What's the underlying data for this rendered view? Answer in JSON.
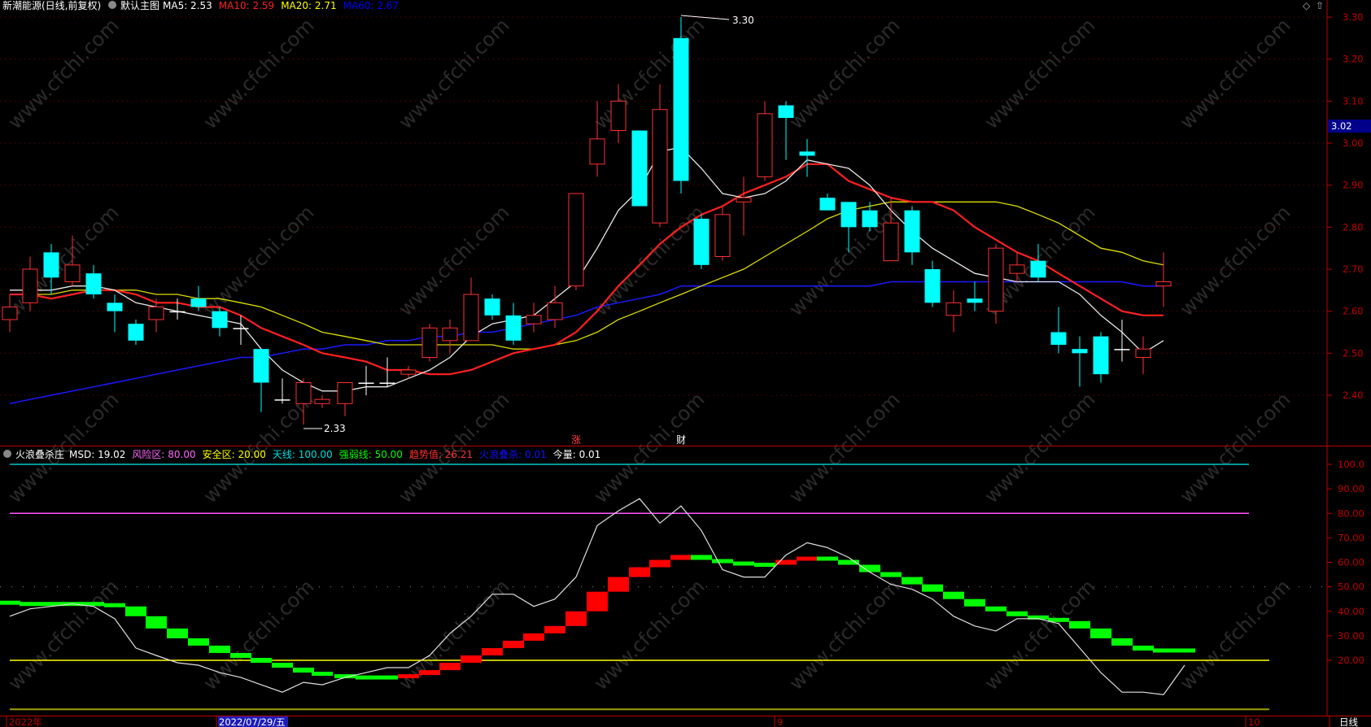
{
  "main_header": {
    "stock_name": "新潮能源(日线,前复权)",
    "indicator_name": "默认主图",
    "items": [
      {
        "text": "MA5: 2.53",
        "color": "#ffffff"
      },
      {
        "text": "MA10: 2.59",
        "color": "#ff2020"
      },
      {
        "text": "MA20: 2.71",
        "color": "#ffff00"
      },
      {
        "text": "MA60: 2.67",
        "color": "#0000ff"
      }
    ]
  },
  "sub_header": {
    "indicator_name": "火浪叠杀庄",
    "items": [
      {
        "text": "MSD: 19.02",
        "color": "#ffffff"
      },
      {
        "text": "风险区: 80.00",
        "color": "#ff66ff"
      },
      {
        "text": "安全区: 20.00",
        "color": "#ffff00"
      },
      {
        "text": "天线: 100.00",
        "color": "#00e0e0"
      },
      {
        "text": "强弱线: 50.00",
        "color": "#00ff00"
      },
      {
        "text": "趋势值: 26.21",
        "color": "#ff3030"
      },
      {
        "text": "火浪叠杀: 0.01",
        "color": "#1010ff"
      },
      {
        "text": "今量: 0.01",
        "color": "#ffffff"
      }
    ]
  },
  "main_annotations": {
    "high": "3.30",
    "low": "2.33",
    "current_price": "3.02",
    "events": [
      {
        "text": "涨",
        "bar_index": 27
      },
      {
        "text": "财",
        "bar_index": 32
      }
    ]
  },
  "bottom_bar": {
    "labels": [
      {
        "text": "2022年",
        "bar_index": 0,
        "highlight": false
      },
      {
        "text": "2022/07/29/五",
        "bar_index": 10,
        "highlight": true
      },
      {
        "text": "9",
        "bar_index": 34,
        "highlight": false
      },
      {
        "text": "10",
        "bar_index": 56,
        "highlight": false
      }
    ],
    "period": "日线"
  },
  "colors": {
    "up": "#ff3030",
    "down": "#00ffff",
    "ma5": "#e8e8e8",
    "ma10": "#ff2020",
    "ma20": "#dddd00",
    "ma60": "#1a1aff",
    "axis": "#c00000",
    "trend_up": "#ff0000",
    "trend_down": "#00ff00",
    "msd": "#e0e0e0",
    "tianxian": "#00c8c8",
    "risk": "#ff55ff",
    "safe": "#ffff00",
    "strong_weak": "#808080"
  },
  "chart_data": [
    {
      "type": "candlestick",
      "title": "新潮能源(日线,前复权)",
      "ylim": [
        2.3,
        3.32
      ],
      "y_ticks": [
        "2.40",
        "2.50",
        "2.60",
        "2.70",
        "2.80",
        "2.90",
        "3.00",
        "3.10",
        "3.20",
        "3.30"
      ],
      "candles": [
        {
          "o": 2.58,
          "c": 2.61,
          "h": 2.64,
          "l": 2.55
        },
        {
          "o": 2.62,
          "c": 2.7,
          "h": 2.73,
          "l": 2.6
        },
        {
          "o": 2.74,
          "c": 2.68,
          "h": 2.76,
          "l": 2.64
        },
        {
          "o": 2.67,
          "c": 2.71,
          "h": 2.78,
          "l": 2.66
        },
        {
          "o": 2.69,
          "c": 2.64,
          "h": 2.71,
          "l": 2.63
        },
        {
          "o": 2.62,
          "c": 2.6,
          "h": 2.64,
          "l": 2.55
        },
        {
          "o": 2.57,
          "c": 2.53,
          "h": 2.58,
          "l": 2.52
        },
        {
          "o": 2.58,
          "c": 2.61,
          "h": 2.63,
          "l": 2.55
        },
        {
          "o": 2.6,
          "c": 2.6,
          "h": 2.63,
          "l": 2.58
        },
        {
          "o": 2.63,
          "c": 2.61,
          "h": 2.66,
          "l": 2.6
        },
        {
          "o": 2.6,
          "c": 2.56,
          "h": 2.61,
          "l": 2.54
        },
        {
          "o": 2.56,
          "c": 2.56,
          "h": 2.59,
          "l": 2.52
        },
        {
          "o": 2.51,
          "c": 2.43,
          "h": 2.51,
          "l": 2.36
        },
        {
          "o": 2.39,
          "c": 2.39,
          "h": 2.44,
          "l": 2.38
        },
        {
          "o": 2.38,
          "c": 2.43,
          "h": 2.44,
          "l": 2.33
        },
        {
          "o": 2.38,
          "c": 2.39,
          "h": 2.4,
          "l": 2.37
        },
        {
          "o": 2.38,
          "c": 2.43,
          "h": 2.43,
          "l": 2.35
        },
        {
          "o": 2.43,
          "c": 2.43,
          "h": 2.47,
          "l": 2.4
        },
        {
          "o": 2.43,
          "c": 2.43,
          "h": 2.49,
          "l": 2.42
        },
        {
          "o": 2.45,
          "c": 2.46,
          "h": 2.47,
          "l": 2.44
        },
        {
          "o": 2.49,
          "c": 2.56,
          "h": 2.57,
          "l": 2.48
        },
        {
          "o": 2.53,
          "c": 2.56,
          "h": 2.58,
          "l": 2.5
        },
        {
          "o": 2.53,
          "c": 2.64,
          "h": 2.68,
          "l": 2.53
        },
        {
          "o": 2.63,
          "c": 2.59,
          "h": 2.64,
          "l": 2.58
        },
        {
          "o": 2.59,
          "c": 2.53,
          "h": 2.62,
          "l": 2.52
        },
        {
          "o": 2.57,
          "c": 2.59,
          "h": 2.62,
          "l": 2.55
        },
        {
          "o": 2.58,
          "c": 2.62,
          "h": 2.66,
          "l": 2.56
        },
        {
          "o": 2.66,
          "c": 2.88,
          "h": 2.88,
          "l": 2.65
        },
        {
          "o": 2.95,
          "c": 3.01,
          "h": 3.1,
          "l": 2.92
        },
        {
          "o": 3.03,
          "c": 3.1,
          "h": 3.14,
          "l": 3.0
        },
        {
          "o": 3.03,
          "c": 2.85,
          "h": 3.03,
          "l": 2.85
        },
        {
          "o": 2.81,
          "c": 3.08,
          "h": 3.14,
          "l": 2.8
        },
        {
          "o": 3.25,
          "c": 2.91,
          "h": 3.3,
          "l": 2.88
        },
        {
          "o": 2.82,
          "c": 2.71,
          "h": 2.83,
          "l": 2.7
        },
        {
          "o": 2.73,
          "c": 2.83,
          "h": 2.85,
          "l": 2.72
        },
        {
          "o": 2.86,
          "c": 2.87,
          "h": 2.92,
          "l": 2.78
        },
        {
          "o": 2.92,
          "c": 3.07,
          "h": 3.1,
          "l": 2.91
        },
        {
          "o": 3.09,
          "c": 3.06,
          "h": 3.1,
          "l": 2.96
        },
        {
          "o": 2.98,
          "c": 2.97,
          "h": 3.01,
          "l": 2.92
        },
        {
          "o": 2.87,
          "c": 2.84,
          "h": 2.88,
          "l": 2.84
        },
        {
          "o": 2.86,
          "c": 2.8,
          "h": 2.86,
          "l": 2.74
        },
        {
          "o": 2.84,
          "c": 2.8,
          "h": 2.86,
          "l": 2.79
        },
        {
          "o": 2.72,
          "c": 2.81,
          "h": 2.87,
          "l": 2.72
        },
        {
          "o": 2.84,
          "c": 2.74,
          "h": 2.85,
          "l": 2.71
        },
        {
          "o": 2.7,
          "c": 2.62,
          "h": 2.72,
          "l": 2.61
        },
        {
          "o": 2.59,
          "c": 2.62,
          "h": 2.65,
          "l": 2.55
        },
        {
          "o": 2.63,
          "c": 2.62,
          "h": 2.67,
          "l": 2.6
        },
        {
          "o": 2.6,
          "c": 2.75,
          "h": 2.76,
          "l": 2.57
        },
        {
          "o": 2.69,
          "c": 2.71,
          "h": 2.74,
          "l": 2.67
        },
        {
          "o": 2.72,
          "c": 2.68,
          "h": 2.76,
          "l": 2.67
        },
        {
          "o": 2.55,
          "c": 2.52,
          "h": 2.61,
          "l": 2.5
        },
        {
          "o": 2.51,
          "c": 2.5,
          "h": 2.54,
          "l": 2.42
        },
        {
          "o": 2.54,
          "c": 2.45,
          "h": 2.55,
          "l": 2.43
        },
        {
          "o": 2.51,
          "c": 2.51,
          "h": 2.58,
          "l": 2.48
        },
        {
          "o": 2.49,
          "c": 2.51,
          "h": 2.54,
          "l": 2.45
        },
        {
          "o": 2.66,
          "c": 2.67,
          "h": 2.74,
          "l": 2.61
        }
      ],
      "x_positions": [
        12,
        37,
        63,
        89,
        115,
        141,
        167,
        192,
        218,
        244,
        270,
        296,
        321,
        347,
        373,
        396,
        424,
        450,
        476,
        502,
        528,
        553,
        579,
        605,
        631,
        656,
        682,
        708,
        734,
        760,
        786,
        811,
        837,
        862,
        888,
        914,
        940,
        966,
        992,
        1017,
        1043,
        1069,
        1095,
        1121,
        1146,
        1172,
        1198,
        1224,
        1250,
        1276,
        1301,
        1327,
        1353,
        1379,
        1405,
        1430
      ],
      "ma5": [
        2.65,
        2.65,
        2.65,
        2.66,
        2.66,
        2.65,
        2.62,
        2.61,
        2.6,
        2.59,
        2.58,
        2.57,
        2.51,
        2.46,
        2.43,
        2.41,
        2.41,
        2.42,
        2.42,
        2.44,
        2.46,
        2.49,
        2.54,
        2.57,
        2.58,
        2.59,
        2.63,
        2.67,
        2.75,
        2.84,
        2.89,
        2.98,
        2.99,
        2.94,
        2.88,
        2.87,
        2.88,
        2.91,
        2.96,
        2.95,
        2.94,
        2.9,
        2.84,
        2.79,
        2.75,
        2.72,
        2.69,
        2.68,
        2.67,
        2.67,
        2.67,
        2.64,
        2.59,
        2.55,
        2.5,
        2.53
      ],
      "ma10": [
        2.64,
        2.64,
        2.63,
        2.64,
        2.65,
        2.65,
        2.64,
        2.62,
        2.62,
        2.61,
        2.61,
        2.59,
        2.56,
        2.54,
        2.52,
        2.5,
        2.49,
        2.48,
        2.46,
        2.46,
        2.45,
        2.45,
        2.46,
        2.48,
        2.5,
        2.51,
        2.52,
        2.55,
        2.6,
        2.66,
        2.71,
        2.76,
        2.8,
        2.83,
        2.85,
        2.88,
        2.9,
        2.92,
        2.95,
        2.95,
        2.91,
        2.89,
        2.87,
        2.86,
        2.86,
        2.84,
        2.8,
        2.77,
        2.74,
        2.72,
        2.69,
        2.66,
        2.63,
        2.6,
        2.59,
        2.59
      ],
      "ma20": [
        2.64,
        2.64,
        2.64,
        2.65,
        2.65,
        2.65,
        2.65,
        2.64,
        2.64,
        2.63,
        2.63,
        2.62,
        2.61,
        2.59,
        2.57,
        2.55,
        2.54,
        2.53,
        2.52,
        2.52,
        2.52,
        2.52,
        2.52,
        2.52,
        2.51,
        2.51,
        2.52,
        2.53,
        2.55,
        2.58,
        2.6,
        2.62,
        2.64,
        2.66,
        2.68,
        2.7,
        2.73,
        2.76,
        2.79,
        2.82,
        2.84,
        2.85,
        2.86,
        2.86,
        2.86,
        2.86,
        2.86,
        2.86,
        2.85,
        2.83,
        2.81,
        2.78,
        2.75,
        2.74,
        2.72,
        2.71
      ],
      "ma60": [
        2.38,
        2.39,
        2.4,
        2.41,
        2.42,
        2.43,
        2.44,
        2.45,
        2.46,
        2.47,
        2.48,
        2.49,
        2.49,
        2.5,
        2.51,
        2.51,
        2.52,
        2.52,
        2.53,
        2.53,
        2.54,
        2.54,
        2.55,
        2.55,
        2.56,
        2.57,
        2.58,
        2.59,
        2.61,
        2.62,
        2.63,
        2.64,
        2.66,
        2.66,
        2.66,
        2.66,
        2.66,
        2.66,
        2.66,
        2.66,
        2.66,
        2.66,
        2.67,
        2.67,
        2.67,
        2.67,
        2.67,
        2.67,
        2.67,
        2.67,
        2.67,
        2.67,
        2.67,
        2.67,
        2.66,
        2.66
      ]
    },
    {
      "type": "line",
      "title": "火浪叠杀庄",
      "ylim": [
        0,
        105
      ],
      "y_ticks": [
        "100.0",
        "90.00",
        "80.00",
        "70.00",
        "60.00",
        "50.00",
        "40.00",
        "30.00",
        "20.00"
      ],
      "levels": {
        "tianxian": 100,
        "risk": 80,
        "strong_weak": 50,
        "safe": 20,
        "bottom": 0
      },
      "msd": [
        38,
        41,
        42,
        43,
        42,
        37,
        25,
        22,
        19,
        18,
        15,
        13,
        10,
        7,
        11,
        10,
        13,
        15,
        17,
        17,
        22,
        31,
        38,
        47,
        47,
        42,
        45,
        54,
        75,
        81,
        86,
        76,
        83,
        73,
        57,
        54,
        54,
        63,
        68,
        66,
        62,
        56,
        51,
        49,
        45,
        38,
        34,
        32,
        37,
        37,
        35,
        25,
        15,
        7,
        7,
        6,
        18
      ],
      "trend": [
        [
          44,
          43
        ],
        [
          43,
          43
        ],
        [
          43,
          43
        ],
        [
          43,
          43
        ],
        [
          43,
          43
        ],
        [
          43,
          42
        ],
        [
          42,
          38
        ],
        [
          38,
          33
        ],
        [
          33,
          29
        ],
        [
          29,
          26
        ],
        [
          26,
          23
        ],
        [
          23,
          21
        ],
        [
          21,
          19
        ],
        [
          19,
          17
        ],
        [
          17,
          15
        ],
        [
          15,
          14
        ],
        [
          14,
          13
        ],
        [
          13,
          13
        ],
        [
          13,
          13
        ],
        [
          13,
          14
        ],
        [
          14,
          16
        ],
        [
          16,
          19
        ],
        [
          19,
          22
        ],
        [
          22,
          25
        ],
        [
          25,
          28
        ],
        [
          28,
          31
        ],
        [
          31,
          34
        ],
        [
          34,
          40
        ],
        [
          40,
          48
        ],
        [
          48,
          54
        ],
        [
          54,
          58
        ],
        [
          58,
          61
        ],
        [
          61,
          63
        ],
        [
          63,
          61
        ],
        [
          61,
          60
        ],
        [
          60,
          59
        ],
        [
          59,
          59
        ],
        [
          59,
          61
        ],
        [
          61,
          62
        ],
        [
          62,
          61
        ],
        [
          61,
          59
        ],
        [
          59,
          56
        ],
        [
          56,
          54
        ],
        [
          54,
          51
        ],
        [
          51,
          48
        ],
        [
          48,
          45
        ],
        [
          45,
          42
        ],
        [
          42,
          40
        ],
        [
          40,
          38
        ],
        [
          38,
          37
        ],
        [
          37,
          36
        ],
        [
          36,
          33
        ],
        [
          33,
          29
        ],
        [
          29,
          26
        ],
        [
          26,
          24
        ],
        [
          24,
          24
        ],
        [
          24,
          24
        ]
      ]
    }
  ]
}
